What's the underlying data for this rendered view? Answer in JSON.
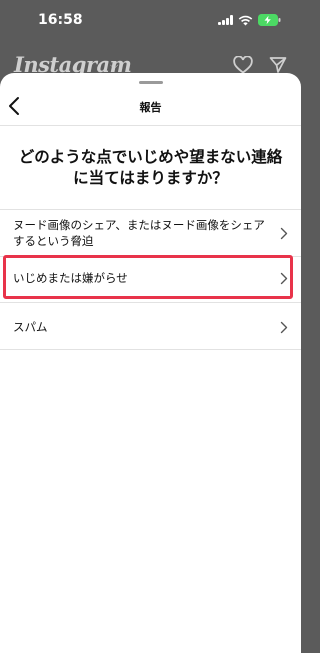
{
  "status_bar": {
    "time": "16:58"
  },
  "background_app": {
    "logo": "Instagram"
  },
  "sheet": {
    "title": "報告",
    "question": "どのような点でいじめや望まない連絡に当てはまりますか？",
    "options": [
      {
        "label": "ヌード画像のシェア、またはヌード画像をシェアするという脅迫"
      },
      {
        "label": "いじめまたは嫌がらせ",
        "highlighted": true
      },
      {
        "label": "スパム"
      }
    ]
  },
  "colors": {
    "highlight_border": "#e8334a",
    "battery_charging": "#4cd964",
    "overlay_background": "#5b5b5b"
  }
}
